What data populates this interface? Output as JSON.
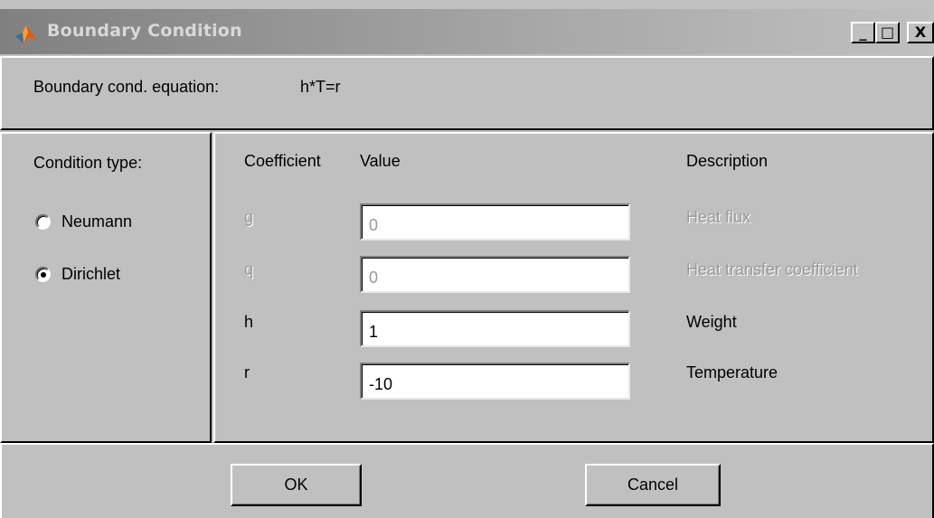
{
  "window": {
    "title": "Boundary Condition",
    "controls": {
      "minimize": "_",
      "maximize": "□",
      "close": "X"
    },
    "icon": "matlab-logo-icon"
  },
  "equation": {
    "label": "Boundary cond. equation:",
    "value": "h*T=r"
  },
  "condition_type": {
    "label": "Condition type:",
    "options": [
      {
        "label": "Neumann",
        "selected": false
      },
      {
        "label": "Dirichlet",
        "selected": true
      }
    ]
  },
  "table": {
    "headers": {
      "coefficient": "Coefficient",
      "value": "Value",
      "description": "Description"
    },
    "rows": [
      {
        "coefficient": "g",
        "value": "0",
        "description": "Heat flux",
        "enabled": false
      },
      {
        "coefficient": "q",
        "value": "0",
        "description": "Heat transfer coefficient",
        "enabled": false
      },
      {
        "coefficient": "h",
        "value": "1",
        "description": "Weight",
        "enabled": true
      },
      {
        "coefficient": "r",
        "value": "-10",
        "description": "Temperature",
        "enabled": true
      }
    ]
  },
  "buttons": {
    "ok": "OK",
    "cancel": "Cancel"
  }
}
